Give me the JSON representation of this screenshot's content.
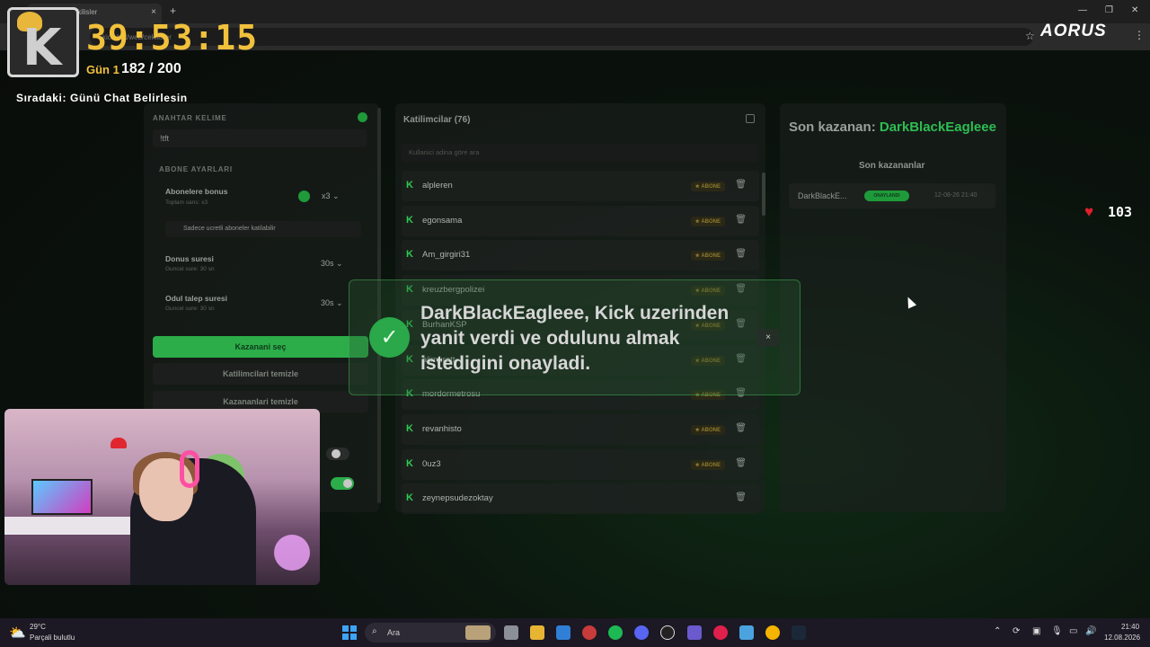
{
  "browser": {
    "tab_title": "BotBit | Çekilisler",
    "url": "kick.bot/web/cekilisler",
    "brand": "AORUS"
  },
  "overlay": {
    "timer": "39:53:15",
    "day_label": "Gün 1",
    "day_count": "182 / 200",
    "next_text": "Sıradaki: Günü Chat Belirlesin"
  },
  "left_panel": {
    "keyword_label": "ANAHTAR KELIME",
    "keyword_value": "!tft",
    "sub_settings_label": "ABONE AYARLARI",
    "sub_bonus_title": "Abonelere bonus",
    "sub_bonus_sub": "Toplam sans: x3",
    "sub_bonus_value": "x3",
    "paid_only_text": "Sadece ucretli aboneler katilabilir",
    "duration_title": "Donus suresi",
    "duration_sub": "Guncel sure: 30 sn",
    "duration_value": "30s",
    "claim_title": "Odul talep suresi",
    "claim_sub": "Guncel sure: 30 sn",
    "claim_value": "30s",
    "pick_button": "Kazanani seç",
    "clear_participants": "Katilimcilari temizle",
    "clear_winners": "Kazananlari temizle"
  },
  "participants": {
    "title": "Katilimcilar (76)",
    "search_placeholder": "Kullanici adina göre ara",
    "rows": [
      {
        "name": "alpleren",
        "badge": "★ ABONE"
      },
      {
        "name": "egonsama",
        "badge": "★ ABONE"
      },
      {
        "name": "Am_girgiri31",
        "badge": "★ ABONE"
      },
      {
        "name": "kreuzbergpolizei",
        "badge": "★ ABONE"
      },
      {
        "name": "BurhanKSP",
        "badge": "★ ABONE"
      },
      {
        "name": "alimuratt",
        "badge": "★ ABONE"
      },
      {
        "name": "mordormetrosu",
        "badge": "★ ABONE"
      },
      {
        "name": "revanhisto",
        "badge": "★ ABONE"
      },
      {
        "name": "0uz3",
        "badge": "★ ABONE"
      },
      {
        "name": "zeynepsudezoktay",
        "badge": ""
      }
    ]
  },
  "winners": {
    "title_prefix": "Son kazanan:",
    "title_name": "DarkBlackEagleee",
    "list_title": "Son kazananlar",
    "row_name": "DarkBlackE...",
    "row_badge": "ONAYLANDI",
    "row_time": "12-08-26 21:40"
  },
  "heart_counter": "103",
  "toast": {
    "message": "DarkBlackEagleee, Kick uzerinden yanit verdi ve odulunu almak istedigini onayladi.",
    "close": "×"
  },
  "taskbar": {
    "temp": "29°C",
    "weather": "Parçali bulutlu",
    "search": "Ara",
    "time": "21:40",
    "date": "12.08.2026"
  },
  "colors": {
    "accent_green": "#2cad4a",
    "timer_yellow": "#f1c13c",
    "kick_green": "#2ecc50"
  }
}
